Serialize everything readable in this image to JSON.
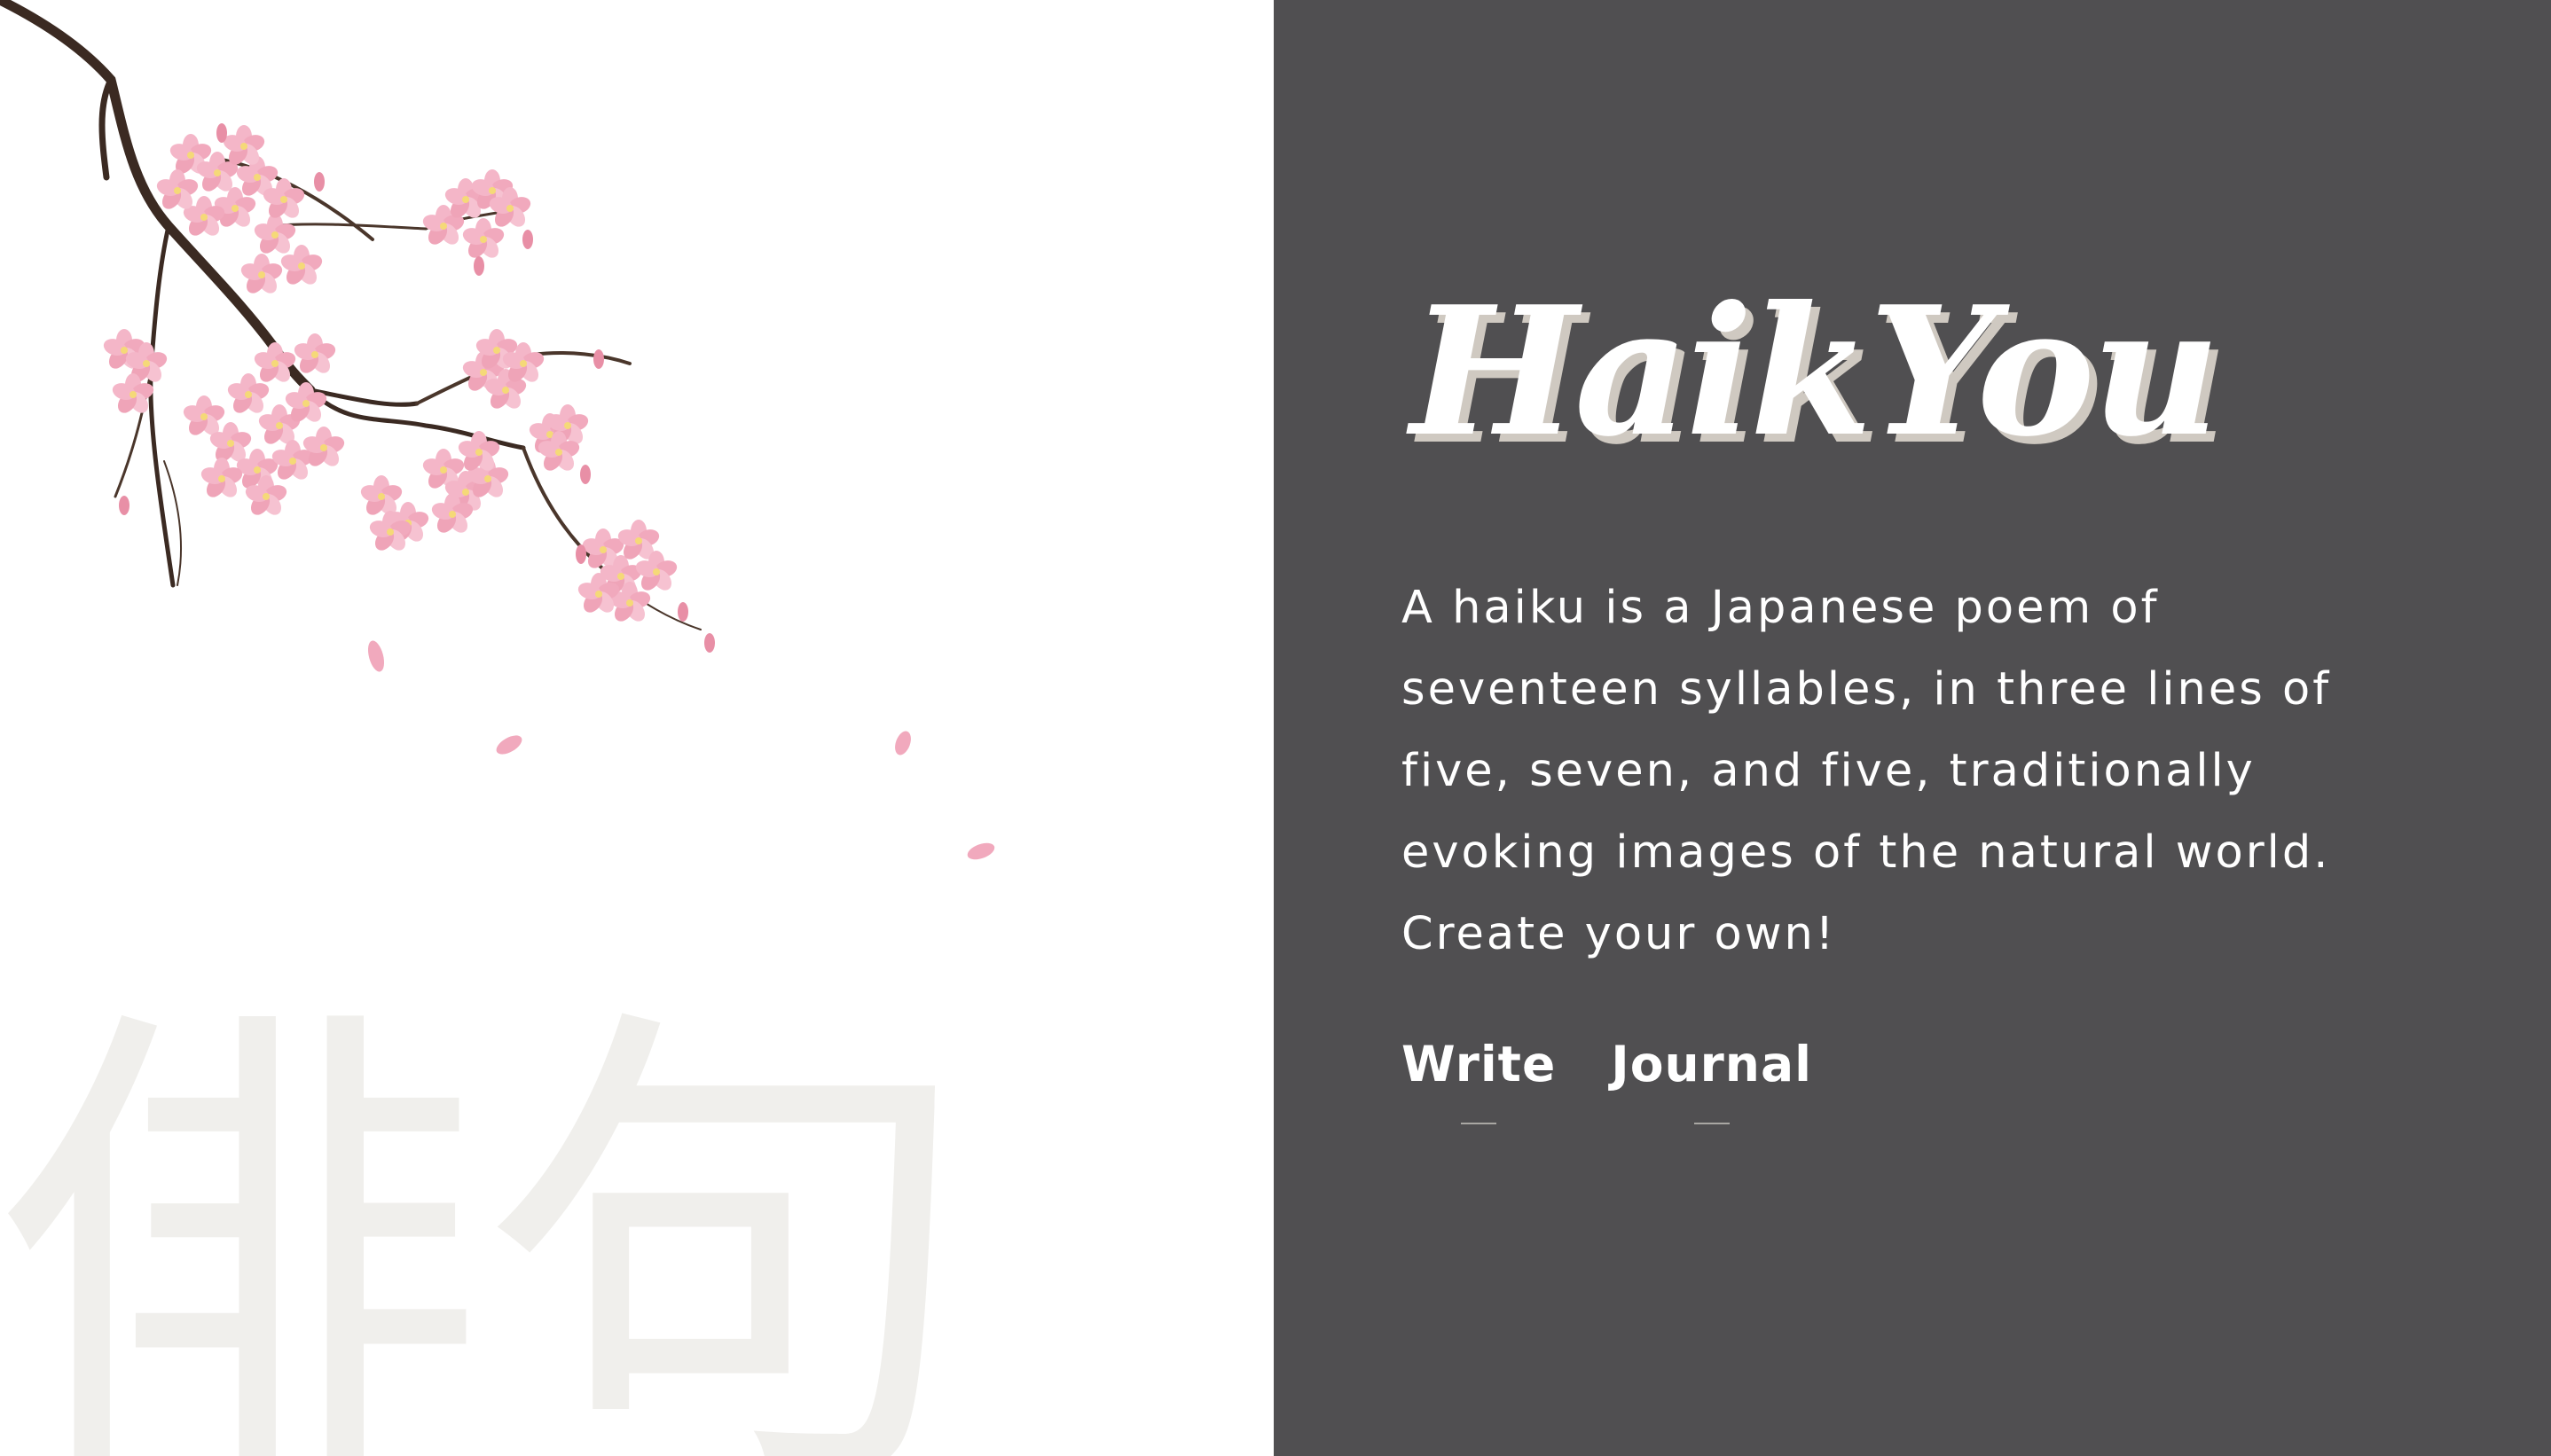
{
  "brand": {
    "name": "HaikYou"
  },
  "decor": {
    "kanji": "俳句"
  },
  "intro": {
    "lines": [
      "A haiku is a Japanese poem of",
      "seventeen syllables, in three lines of",
      "five, seven, and five, traditionally",
      "evoking images of the natural world.",
      "Create your own!"
    ]
  },
  "nav": {
    "items": [
      {
        "label": "Write"
      },
      {
        "label": "Journal"
      }
    ]
  },
  "colors": {
    "panel": "#504f51",
    "logo_shadow": "#cfc9c1",
    "blossom": "#f4b6c8",
    "branch": "#3b2a22",
    "kanji": "#f0efec"
  },
  "icons": {
    "branch": "cherry-blossom-branch"
  }
}
